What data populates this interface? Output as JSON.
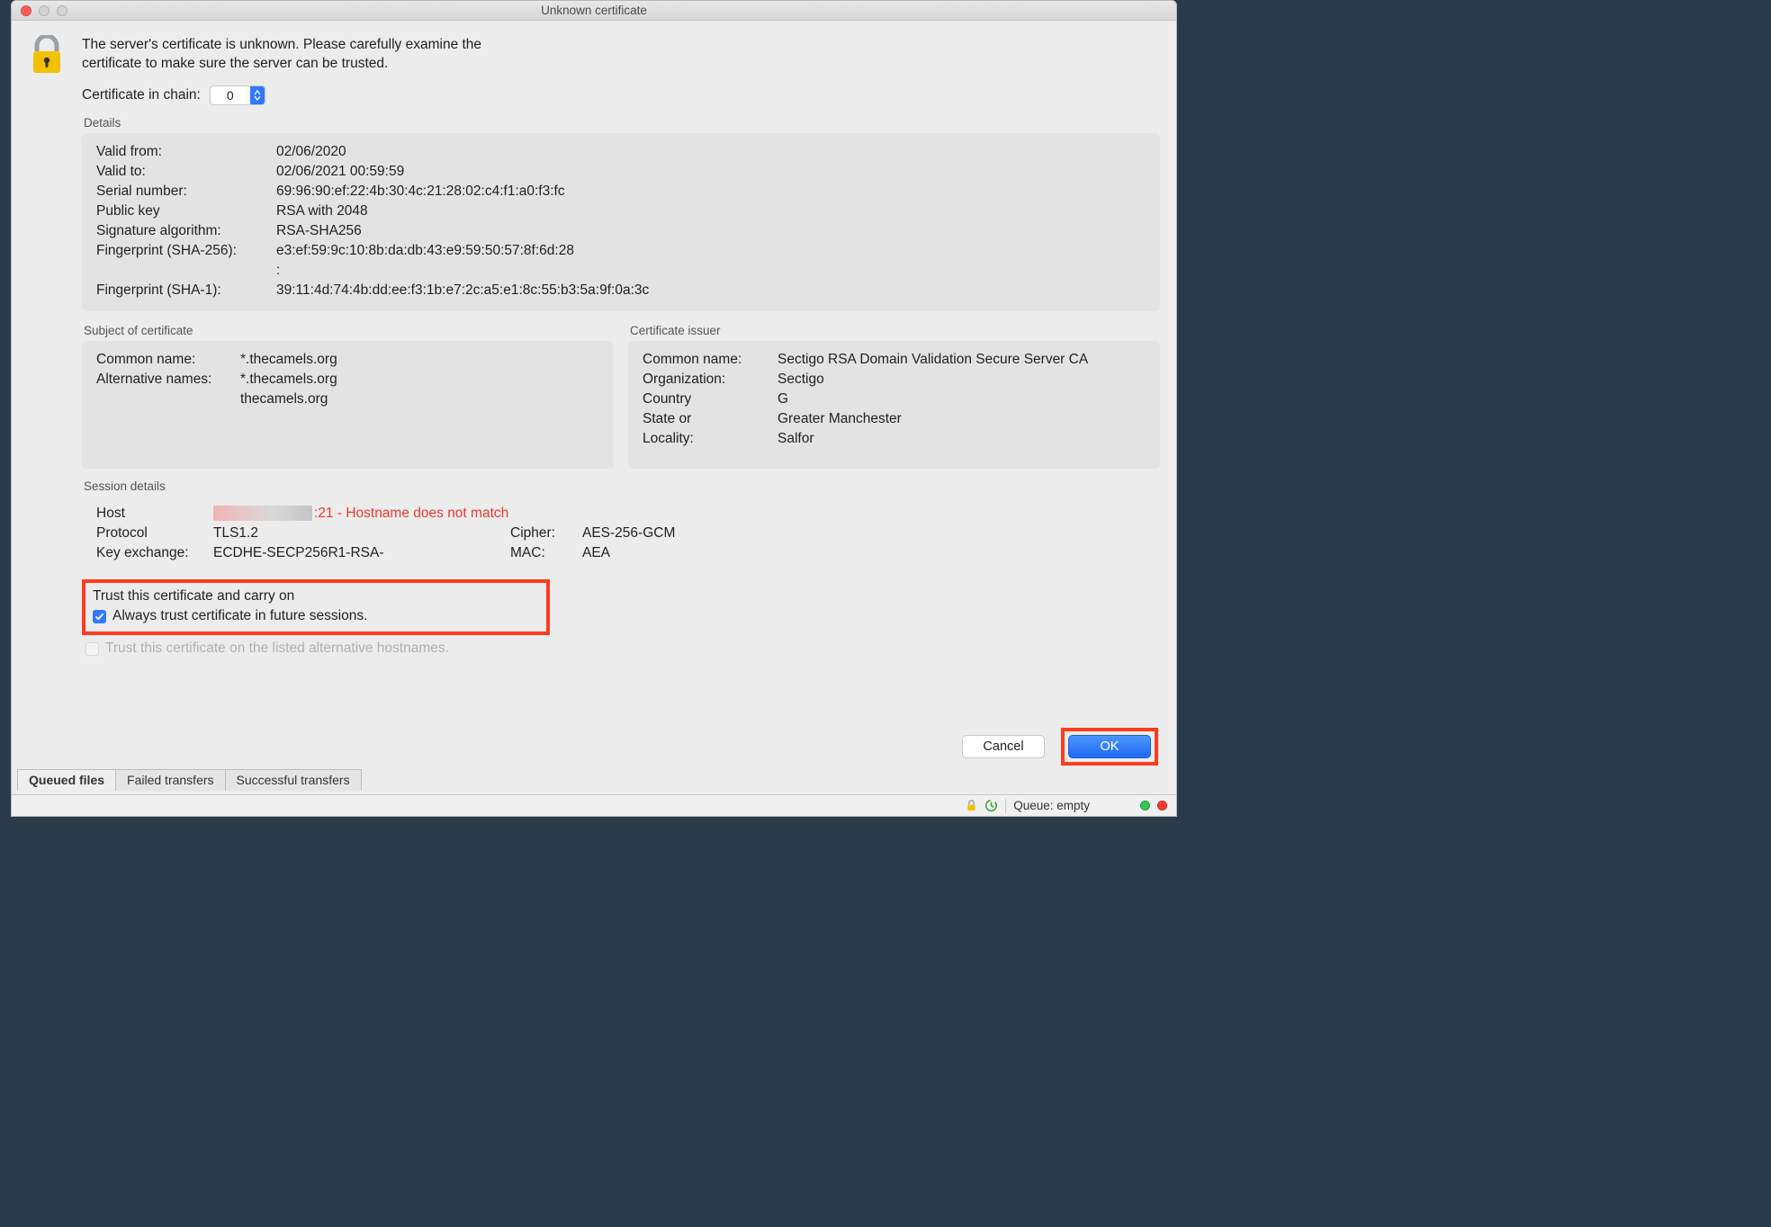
{
  "window": {
    "title": "Unknown certificate"
  },
  "intro": {
    "line1": "The server's certificate is unknown. Please carefully examine the",
    "line2": "certificate to make sure the server can be trusted."
  },
  "chain": {
    "label": "Certificate in chain:",
    "value": "0"
  },
  "details": {
    "legend": "Details",
    "valid_from_k": "Valid from:",
    "valid_from_v": "02/06/2020",
    "valid_to_k": "Valid to:",
    "valid_to_v": "02/06/2021 00:59:59",
    "serial_k": "Serial number:",
    "serial_v": "69:96:90:ef:22:4b:30:4c:21:28:02:c4:f1:a0:f3:fc",
    "pubkey_k": "Public key",
    "pubkey_v": "RSA with 2048",
    "sigalg_k": "Signature algorithm:",
    "sigalg_v": "RSA-SHA256",
    "fp256_k": "Fingerprint (SHA-256):",
    "fp256_v": "e3:ef:59:9c:10:8b:da:db:43:e9:59:50:57:8f:6d:28",
    "fp256_cont": ":",
    "fp1_k": "Fingerprint (SHA-1):",
    "fp1_v": "39:11:4d:74:4b:dd:ee:f3:1b:e7:2c:a5:e1:8c:55:b3:5a:9f:0a:3c"
  },
  "subject": {
    "legend": "Subject of certificate",
    "cn_k": "Common name:",
    "cn_v": "*.thecamels.org",
    "alt_k": "Alternative names:",
    "alt_v1": "*.thecamels.org",
    "alt_v2": "thecamels.org"
  },
  "issuer": {
    "legend": "Certificate issuer",
    "cn_k": "Common name:",
    "cn_v": "Sectigo RSA Domain Validation Secure Server CA",
    "org_k": "Organization:",
    "org_v": "Sectigo",
    "country_k": "Country",
    "country_v": "G",
    "state_k": "State or",
    "state_v": "Greater Manchester",
    "loc_k": "Locality:",
    "loc_v": "Salfor"
  },
  "session": {
    "legend": "Session details",
    "host_k": "Host",
    "host_v_text": ":21 - Hostname does not match",
    "proto_k": "Protocol",
    "proto_v": "TLS1.2",
    "cipher_k": "Cipher:",
    "cipher_v": "AES-256-GCM",
    "kex_k": "Key exchange:",
    "kex_v": "ECDHE-SECP256R1-RSA-",
    "mac_k": "MAC:",
    "mac_v": "AEA"
  },
  "trust": {
    "heading": "Trust this certificate and carry on",
    "always": "Always trust certificate in future sessions.",
    "alt_hosts": "Trust this certificate on the listed alternative hostnames."
  },
  "buttons": {
    "cancel": "Cancel",
    "ok": "OK"
  },
  "tabs": {
    "queued": "Queued files",
    "failed": "Failed transfers",
    "success": "Successful transfers"
  },
  "status": {
    "queue": "Queue: empty"
  }
}
